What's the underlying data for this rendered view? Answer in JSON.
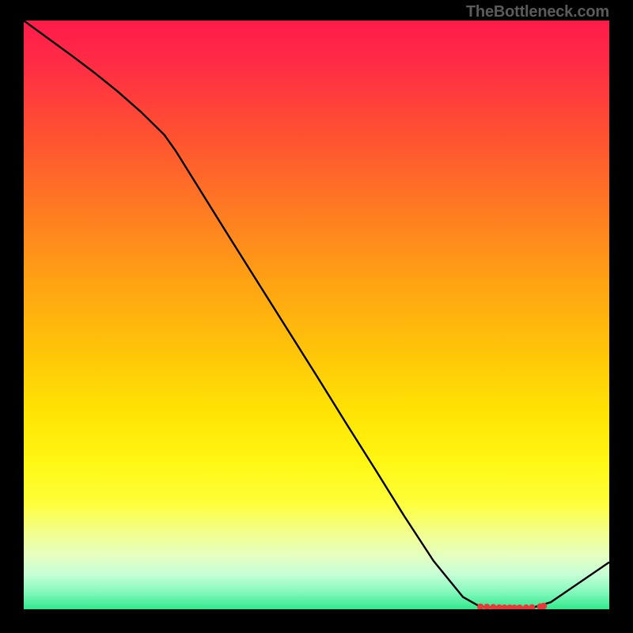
{
  "watermark": "TheBottleneck.com",
  "chart_data": {
    "type": "line",
    "title": "",
    "xlabel": "",
    "ylabel": "",
    "xlim": [
      0,
      100
    ],
    "ylim": [
      0,
      100
    ],
    "grid": false,
    "legend": false,
    "series": [
      {
        "name": "curve",
        "x": [
          0,
          4,
          8,
          12,
          16,
          20,
          24,
          26,
          30,
          35,
          40,
          45,
          50,
          55,
          60,
          65,
          70,
          75,
          78,
          82,
          85,
          87,
          90,
          100
        ],
        "values": [
          100,
          97.1,
          94.2,
          91.2,
          88.0,
          84.5,
          80.6,
          77.8,
          71.4,
          63.4,
          55.5,
          47.6,
          39.7,
          31.7,
          23.8,
          15.8,
          8.2,
          2.1,
          0.4,
          0.2,
          0.2,
          0.3,
          1.2,
          8.0
        ]
      }
    ],
    "points": {
      "name": "cluster",
      "x": [
        78.0,
        79.1,
        80.2,
        81.2,
        82.1,
        83.0,
        83.8,
        84.7,
        85.8,
        86.8,
        88.2,
        88.8
      ],
      "values": [
        0.41,
        0.38,
        0.32,
        0.27,
        0.25,
        0.24,
        0.23,
        0.24,
        0.26,
        0.3,
        0.45,
        0.55
      ]
    },
    "colors": {
      "line": "#000000",
      "points": "#e63a3a"
    }
  }
}
